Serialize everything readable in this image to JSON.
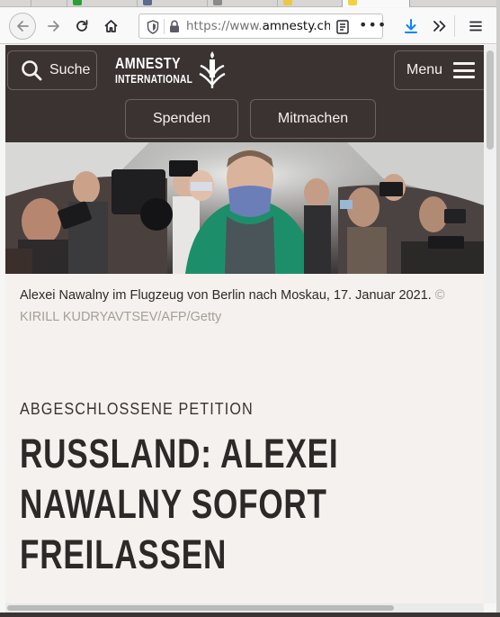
{
  "browser": {
    "url_prefix": "https://www.",
    "url_domain": "amnesty.ch",
    "url_suffix": "/",
    "accent": "#0a84ff"
  },
  "site": {
    "logo_line1": "AMNESTY",
    "logo_line2": "INTERNATIONAL",
    "search_label": "Suche",
    "menu_label": "Menu",
    "donate_label": "Spenden",
    "join_label": "Mitmachen",
    "header_color": "#3b3232"
  },
  "article": {
    "caption": "Alexei Nawalny im Flugzeug von Berlin nach Moskau, 17. Januar 2021.",
    "credit": "© KIRILL KUDRYAVTSEV/AFP/Getty",
    "kicker": "ABGESCHLOSSENE PETITION",
    "headline_lines": [
      "RUSSLAND: ALEXEI",
      "NAWALNY SOFORT",
      "FREILASSEN"
    ]
  }
}
